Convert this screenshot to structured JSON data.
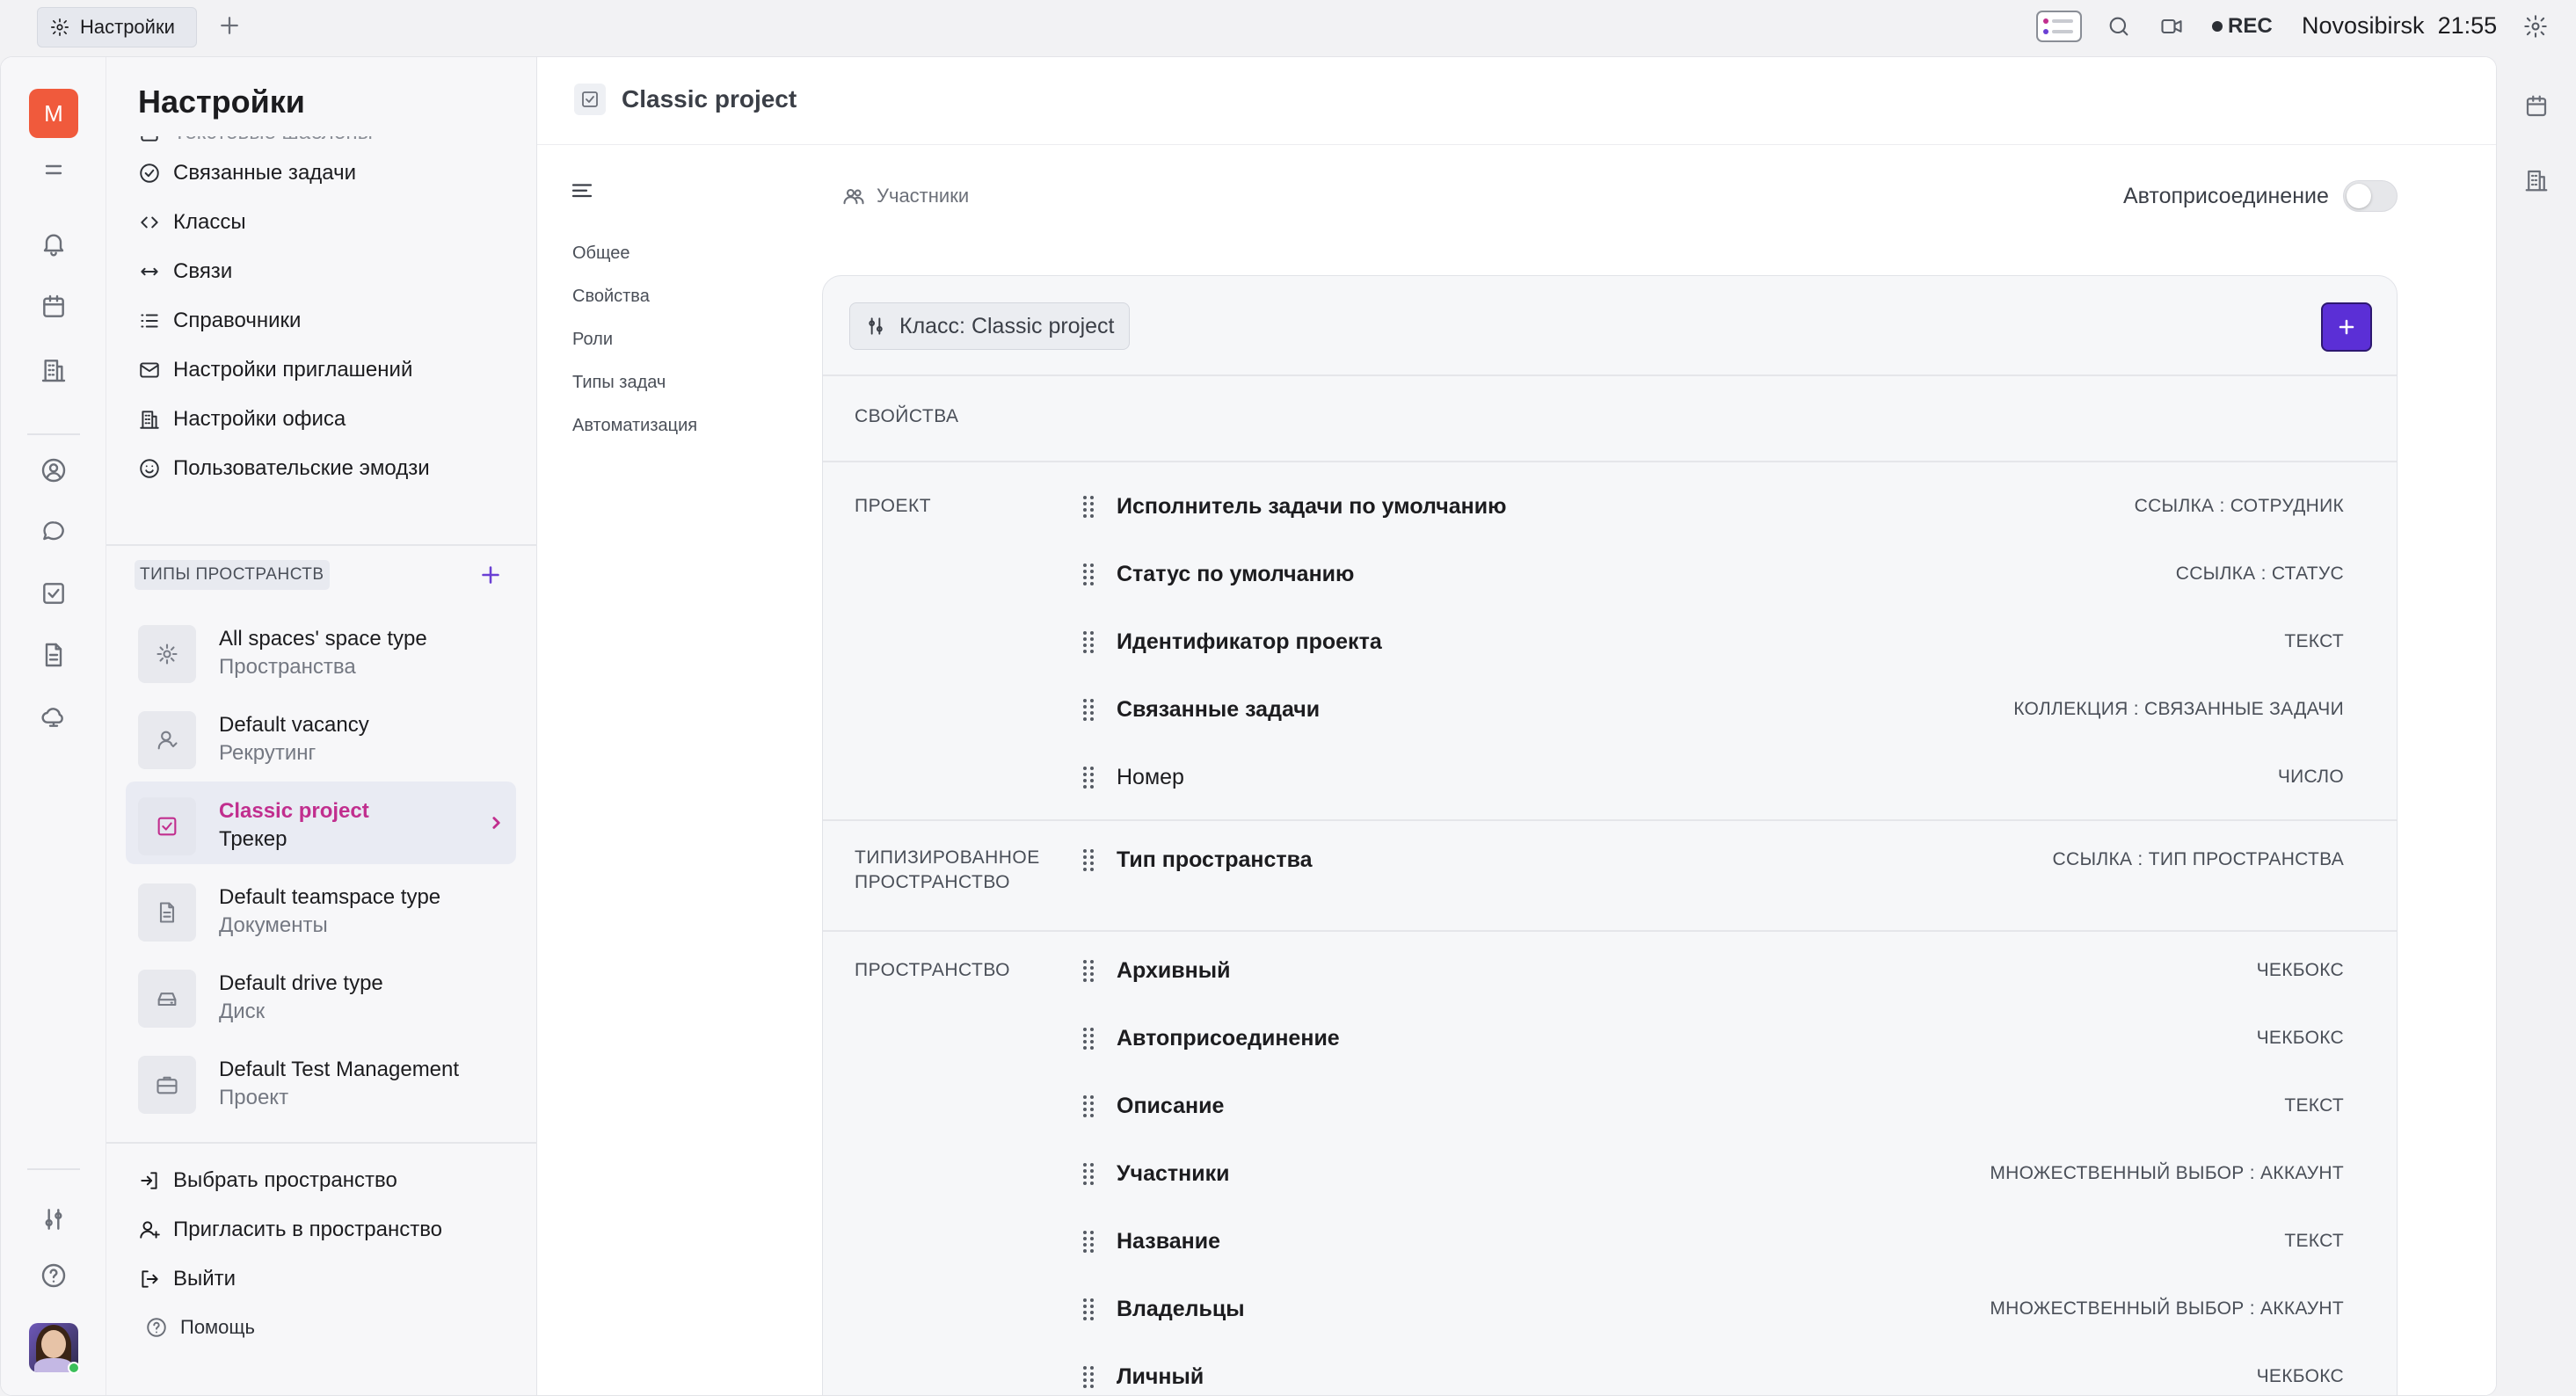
{
  "window": {
    "tab_label": "Настройки",
    "rec_label": "REC",
    "location": "Novosibirsk",
    "time": "21:55"
  },
  "rail": {
    "workspace_initial": "M"
  },
  "sidebar": {
    "title": "Настройки",
    "partial_item": "Текстовые шаблоны",
    "items": [
      {
        "label": "Связанные задачи",
        "icon": "check-circle-icon"
      },
      {
        "label": "Классы",
        "icon": "code-icon"
      },
      {
        "label": "Связи",
        "icon": "arrows-icon"
      },
      {
        "label": "Справочники",
        "icon": "list-icon"
      },
      {
        "label": "Настройки приглашений",
        "icon": "mail-icon"
      },
      {
        "label": "Настройки офиса",
        "icon": "building-icon"
      },
      {
        "label": "Пользовательские эмодзи",
        "icon": "smile-icon"
      }
    ],
    "space_types_header": "ТИПЫ ПРОСТРАНСТВ",
    "space_types": [
      {
        "name": "All spaces' space type",
        "sub": "Пространства",
        "icon": "gear-icon"
      },
      {
        "name": "Default vacancy",
        "sub": "Рекрутинг",
        "icon": "person-icon"
      },
      {
        "name": "Classic project",
        "sub": "Трекер",
        "icon": "task-icon"
      },
      {
        "name": "Default teamspace type",
        "sub": "Документы",
        "icon": "document-icon"
      },
      {
        "name": "Default drive type",
        "sub": "Диск",
        "icon": "drive-icon"
      },
      {
        "name": "Default Test Management",
        "sub": "Проект",
        "icon": "briefcase-icon"
      }
    ],
    "bottom_items": [
      {
        "label": "Выбрать пространство"
      },
      {
        "label": "Пригласить в пространство"
      },
      {
        "label": "Выйти"
      }
    ],
    "help_label": "Помощь"
  },
  "content": {
    "title": "Classic project",
    "toc": [
      "Общее",
      "Свойства",
      "Роли",
      "Типы задач",
      "Автоматизация"
    ],
    "members_label": "Участники",
    "autojoin_label": "Автоприсоединение",
    "autojoin_enabled": false,
    "class_button": "Класс: Classic project",
    "properties_label": "СВОЙСТВА",
    "groups": [
      {
        "label": "ПРОЕКТ",
        "rows": [
          {
            "name": "Исполнитель задачи по умолчанию",
            "type": "ССЫЛКА : СОТРУДНИК",
            "bold": true
          },
          {
            "name": "Статус по умолчанию",
            "type": "ССЫЛКА : СТАТУС",
            "bold": true
          },
          {
            "name": "Идентификатор проекта",
            "type": "ТЕКСТ",
            "bold": true
          },
          {
            "name": "Связанные задачи",
            "type": "КОЛЛЕКЦИЯ : СВЯЗАННЫЕ ЗАДАЧИ",
            "bold": true
          },
          {
            "name": "Номер",
            "type": "ЧИСЛО",
            "bold": false
          }
        ]
      },
      {
        "label": "ТИПИЗИРОВАННОЕ ПРОСТРАНСТВО",
        "rows": [
          {
            "name": "Тип пространства",
            "type": "ССЫЛКА : ТИП ПРОСТРАНСТВА",
            "bold": true
          }
        ]
      },
      {
        "label": "ПРОСТРАНСТВО",
        "rows": [
          {
            "name": "Архивный",
            "type": "ЧЕКБОКС",
            "bold": true
          },
          {
            "name": "Автоприсоединение",
            "type": "ЧЕКБОКС",
            "bold": true
          },
          {
            "name": "Описание",
            "type": "ТЕКСТ",
            "bold": true
          },
          {
            "name": "Участники",
            "type": "МНОЖЕСТВЕННЫЙ ВЫБОР : АККАУНТ",
            "bold": true
          },
          {
            "name": "Название",
            "type": "ТЕКСТ",
            "bold": true
          },
          {
            "name": "Владельцы",
            "type": "МНОЖЕСТВЕННЫЙ ВЫБОР : АККАУНТ",
            "bold": true
          },
          {
            "name": "Личный",
            "type": "ЧЕКБОКС",
            "bold": true
          }
        ]
      }
    ]
  },
  "colors": {
    "accent": "#5b2fd6",
    "active_item": "#c12e8e",
    "workspace_badge": "#f05a3c"
  }
}
